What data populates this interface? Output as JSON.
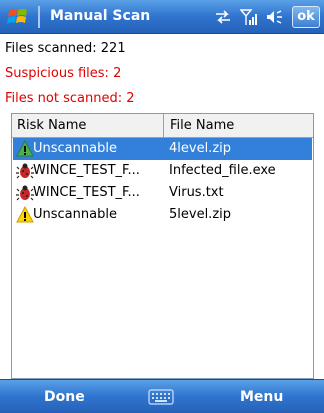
{
  "titlebar": {
    "title": "Manual Scan",
    "ok_label": "ok",
    "icons": [
      "windows-start-flag",
      "connectivity-arrows",
      "signal-bars",
      "volume-speaker"
    ]
  },
  "stats": {
    "files_scanned": "Files scanned: 221",
    "suspicious_files": "Suspicious files: 2",
    "files_not_scanned": "Files not scanned: 2"
  },
  "colors": {
    "accent": "#2f74cf",
    "selected_row": "#3380db",
    "alert_text": "#e00000"
  },
  "list": {
    "columns": [
      "Risk Name",
      "File Name"
    ],
    "rows": [
      {
        "icon": "warning-icon",
        "risk": "Unscannable",
        "file": "4level.zip",
        "selected": true
      },
      {
        "icon": "virus-bug-icon",
        "risk": "WINCE_TEST_F...",
        "file": "Infected_file.exe",
        "selected": false
      },
      {
        "icon": "virus-bug-icon",
        "risk": "WINCE_TEST_F...",
        "file": "Virus.txt",
        "selected": false
      },
      {
        "icon": "warning-icon",
        "risk": "Unscannable",
        "file": "5level.zip",
        "selected": false
      }
    ]
  },
  "softkeys": {
    "left": "Done",
    "right": "Menu",
    "center_icon": "keyboard-icon"
  }
}
